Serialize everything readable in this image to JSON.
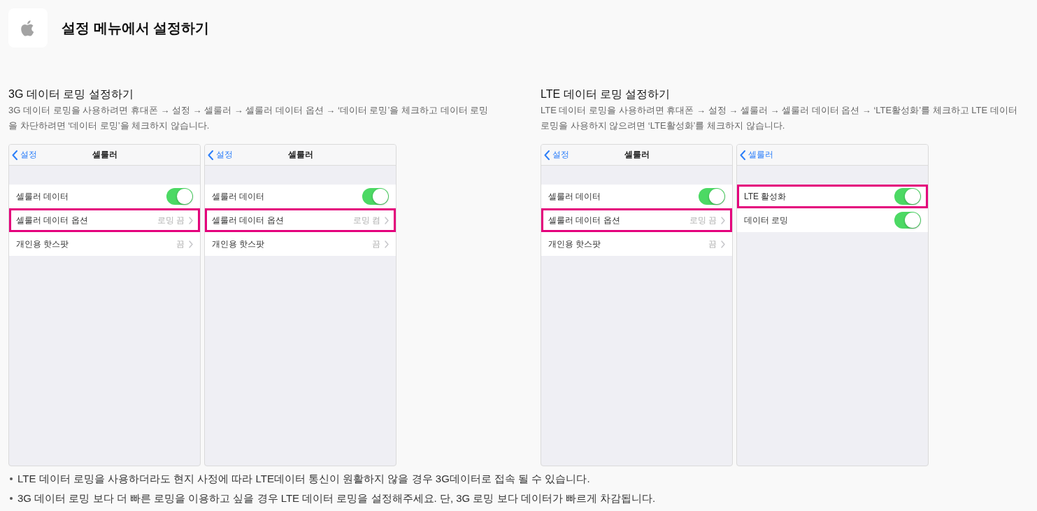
{
  "header": {
    "title": "설정 메뉴에서 설정하기"
  },
  "sections": [
    {
      "title": "3G 데이터 로밍 설정하기",
      "description": "3G 데이터 로밍을 사용하려면 휴대폰 → 설정 → 셀룰러 → 셀룰러 데이터 옵션 → ‘데이터 로밍’을 체크하고 데이터 로밍을 차단하려면 ‘데이터 로밍’을 체크하지 않습니다.",
      "screens": [
        {
          "back_label": "설정",
          "title": "셀룰러",
          "rows": [
            {
              "kind": "toggle",
              "label": "셀룰러 데이터",
              "on": true,
              "highlighted": false
            },
            {
              "kind": "link",
              "label": "셀룰러 데이터 옵션",
              "value": "로밍 끔",
              "highlighted": true
            },
            {
              "kind": "link",
              "label": "개인용 핫스팟",
              "value": "끔",
              "highlighted": false
            }
          ]
        },
        {
          "back_label": "설정",
          "title": "셀룰러",
          "rows": [
            {
              "kind": "toggle",
              "label": "셀룰러 데이터",
              "on": true,
              "highlighted": false
            },
            {
              "kind": "link",
              "label": "셀룰러 데이터 옵션",
              "value": "로밍 켬",
              "highlighted": true
            },
            {
              "kind": "link",
              "label": "개인용 핫스팟",
              "value": "끔",
              "highlighted": false
            }
          ]
        }
      ]
    },
    {
      "title": "LTE 데이터 로밍 설정하기",
      "description": "LTE 데이터 로밍을 사용하려면 휴대폰 → 설정 → 셀룰러 → 셀룰러 데이터 옵션 → ‘LTE활성화’를 체크하고 LTE 데이터 로밍을 사용하지 않으려면 ‘LTE활성화’를 체크하지 않습니다.",
      "screens": [
        {
          "back_label": "설정",
          "title": "셀룰러",
          "rows": [
            {
              "kind": "toggle",
              "label": "셀룰러 데이터",
              "on": true,
              "highlighted": false
            },
            {
              "kind": "link",
              "label": "셀룰러 데이터 옵션",
              "value": "로밍 끔",
              "highlighted": true
            },
            {
              "kind": "link",
              "label": "개인용 핫스팟",
              "value": "끔",
              "highlighted": false
            }
          ]
        },
        {
          "back_label": "셀룰러",
          "rows": [
            {
              "kind": "toggle",
              "label": "LTE 활성화",
              "on": true,
              "highlighted": true
            },
            {
              "kind": "toggle",
              "label": "데이터 로밍",
              "on": true,
              "highlighted": false
            }
          ]
        }
      ]
    }
  ],
  "notes": [
    "LTE 데이터 로밍을 사용하더라도 현지 사정에 따라 LTE데이터 통신이 원활하지 않을 경우 3G데이터로 접속 될 수 있습니다.",
    "3G 데이터 로밍 보다 더 빠른 로밍을 이용하고 싶을 경우 LTE 데이터 로밍을 설정해주세요. 단, 3G 로밍 보다 데이터가 빠르게 차감됩니다."
  ]
}
